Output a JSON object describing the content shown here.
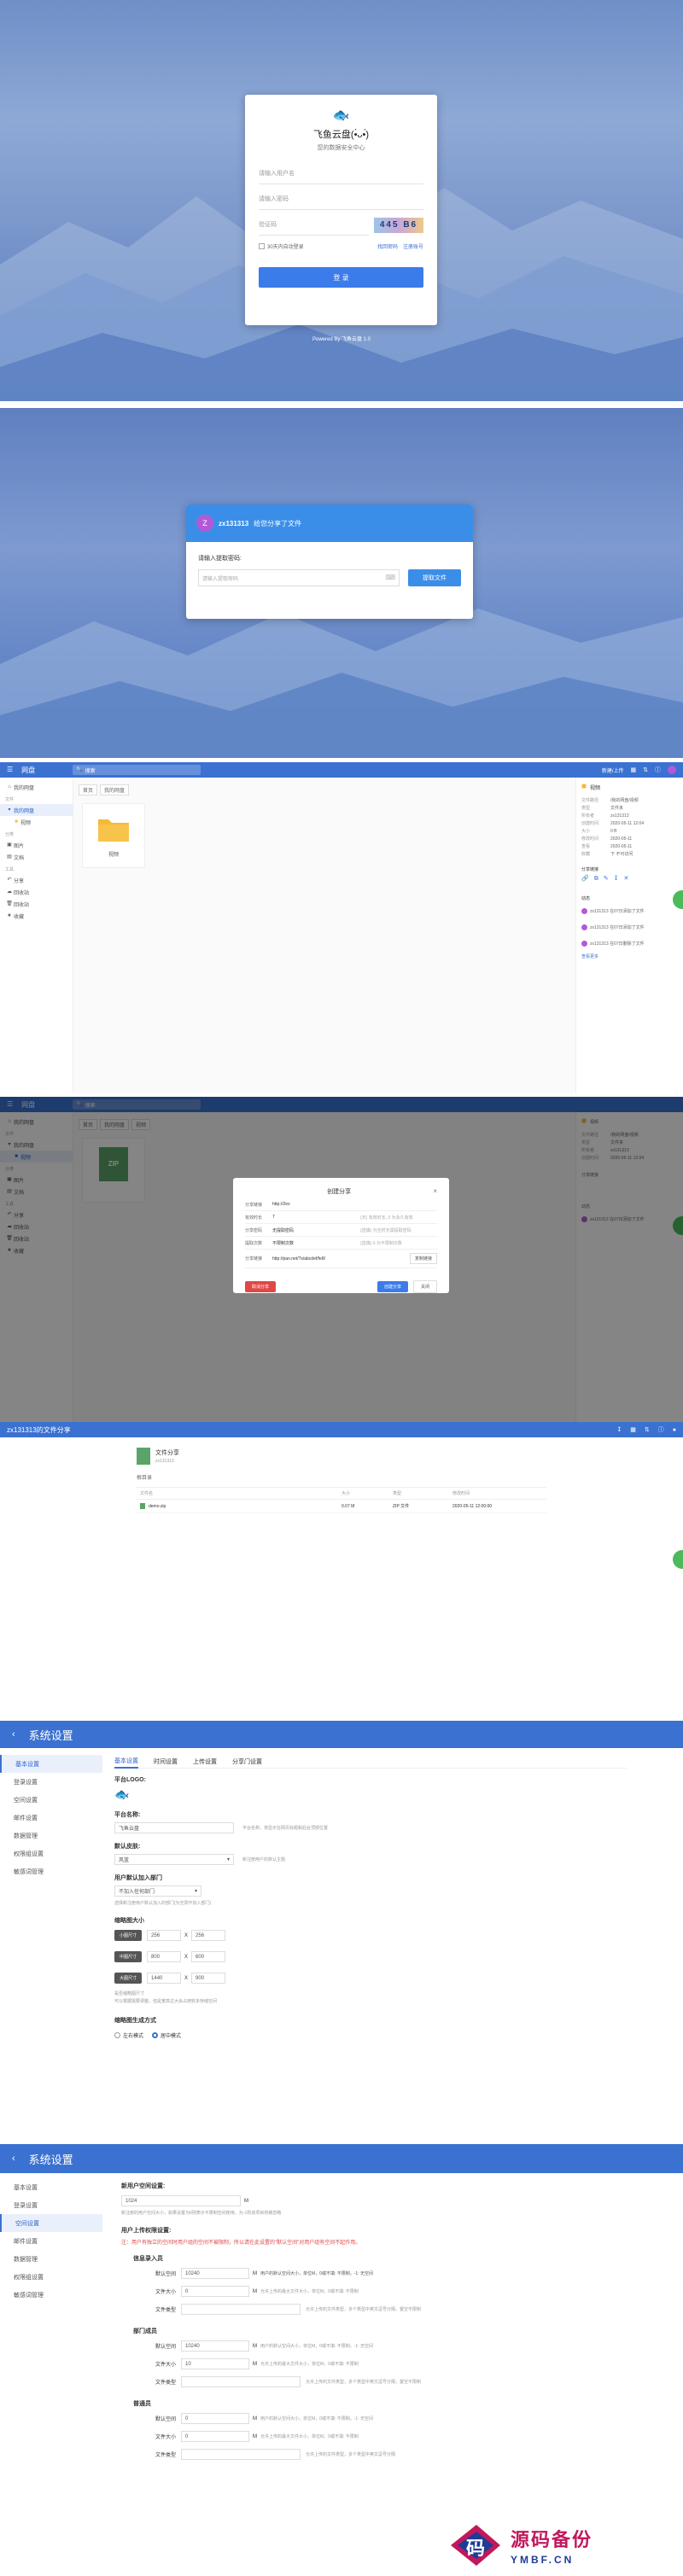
{
  "login": {
    "app_name": "飞鱼云盘(•̀ᴗ•́)",
    "subtitle": "您的数据安全中心",
    "username_placeholder": "请输入用户名",
    "password_placeholder": "请输入密码",
    "captcha_placeholder": "验证码",
    "captcha_text": "445 B6",
    "remember_label": "30天内自动登录",
    "forgot_label": "找回密码",
    "register_label": "注册账号",
    "submit_label": "登 录",
    "powered": "Powered By 飞鱼云盘 1.0"
  },
  "share": {
    "avatar_letter": "Z",
    "user": "zx131313",
    "message": "给您分享了文件",
    "prompt": "请输入提取密码:",
    "input_placeholder": "请输入提取密码",
    "extract_label": "提取文件"
  },
  "filemanager": {
    "app_title": "网盘",
    "search_placeholder": "搜索",
    "upload_label": "新建/上传",
    "sidebar": {
      "home": "我的网盘",
      "folder_head": "文件",
      "my_drive": "我的网盘",
      "sub": "视频",
      "cat_head": "分类",
      "cat1": "图片",
      "cat2": "文档",
      "tool_head": "工具",
      "t1": "分享",
      "t2": "回收站",
      "t3": "回收站",
      "t4": "收藏"
    },
    "crumbs": [
      "首页",
      "我的网盘"
    ],
    "crumbs2": [
      "首页",
      "我的网盘",
      "视频"
    ],
    "folder_name": "视频",
    "zip_name": "ZIP",
    "panel": {
      "title": "视频",
      "fields": [
        [
          "文件路径",
          "/我的网盘/视频"
        ],
        [
          "类型",
          "文件夹"
        ],
        [
          "所有者",
          "zx131313"
        ],
        [
          "创建时间",
          "2020-05-11 12:04"
        ],
        [
          "大小",
          "0 B"
        ],
        [
          "修改时间",
          "2020-05-11"
        ],
        [
          "查看",
          "2020-05-11"
        ],
        [
          "收藏",
          "下 不可访问"
        ]
      ],
      "share_head": "分享链接",
      "activity_head": "动态",
      "activity": [
        "zx131313 在07日添加了文件",
        "zx131313 在07日添加了文件",
        "zx131313 在07日删除了文件"
      ],
      "more": "查看更多"
    }
  },
  "dialog": {
    "title": "创建分享",
    "rows": [
      [
        "分享链接",
        "http://2ex",
        ""
      ],
      [
        "有效时长",
        "7",
        "(天) 有效时长, 0 为永久有效"
      ],
      [
        "分享密码",
        "无提取密码",
        "(选填) 为空时无需提取密码"
      ],
      [
        "提取次数",
        "不限制次数",
        "(选填) 0 为不限制次数"
      ],
      [
        "分享链接",
        "http://pan.net/?s/abcdef/fe8/",
        "复制链接"
      ]
    ],
    "cancel_share": "取消分享",
    "create": "创建分享",
    "close": "关闭"
  },
  "sharepage": {
    "title": "zx131313的文件分享",
    "file_title": "文件分享",
    "file_sub": "zx131313",
    "crumb": "根目录",
    "cols": [
      "文件名",
      "大小",
      "类型",
      "修改时间"
    ],
    "row": [
      "demo.zip",
      "0.07 M",
      "ZIP 文件",
      "2020-05-11 12:00:00"
    ]
  },
  "settings1": {
    "title": "系统设置",
    "nav": [
      "基本设置",
      "登录设置",
      "空间设置",
      "邮件设置",
      "数据管理",
      "权限组设置",
      "敏感词管理"
    ],
    "tabs": [
      "基本设置",
      "时间设置",
      "上传设置",
      "分享门设置"
    ],
    "logo_label": "平台LOGO:",
    "name_label": "平台名称:",
    "name_value": "飞鱼云盘",
    "name_tip": "平台名称，将显示在网页标题和后台顶部位置",
    "theme_label": "默认皮肤:",
    "theme_value": "风蓝",
    "theme_tip": "新注册用户的默认主题",
    "group_label": "用户默认加入部门",
    "group_value": "不加入任何部门",
    "group_tip": "选择新注册用户默认加入的部门(为空则不加入部门)",
    "thumb_label": "缩略图大小",
    "thumb_rows": [
      [
        "小图尺寸",
        "256",
        "256"
      ],
      [
        "中图尺寸",
        "800",
        "600"
      ],
      [
        "大图尺寸",
        "1440",
        "900"
      ]
    ],
    "thumb_tip1": "是否缩略图尺寸",
    "thumb_tip2": "可以根据需要调整，但是宽高过大会占用较多存储空间",
    "cropper_label": "缩略图生成方式",
    "crop_opts": [
      "左右模式",
      "居中模式"
    ]
  },
  "settings2": {
    "title": "系统设置",
    "quota_label": "新用户空间设置:",
    "quota_value": "1024",
    "quota_unit": "M",
    "quota_tip": "新注册的用户空间大小，如果设置为0则表示不限制空间使用，为-1则该项目将被忽略",
    "perm_label": "用户上传权限设置:",
    "perm_note": "注：用户有独立的空间时用户组的空间不被限制，所以请在此设置的\"默认空间\"对用户组有空间不起作用。",
    "groups": [
      {
        "name": "信息录入员",
        "space": "10240",
        "space_tip": "用户的默认空间大小，单位M，0或不填: 不限制，-1: 无空间",
        "size": "0",
        "size_tip": "允许上传的最大文件大小，单位M，0或不填: 不限制",
        "type_tip": "允许上传的文件类型，多个类型中英文逗号分隔，置空不限制"
      },
      {
        "name": "部门成员",
        "space": "10240",
        "space_tip": "用户的默认空间大小，单位M，0或不填: 不限制，-1: 无空间",
        "size": "10",
        "size_tip": "允许上传的最大文件大小，单位M，0或不填: 不限制",
        "type_tip": "允许上传的文件类型，多个类型中英文逗号分隔，置空不限制"
      },
      {
        "name": "普通员",
        "space": "0",
        "space_tip": "用户的默认空间大小，单位M，0或不填: 不限制，-1: 无空间",
        "size": "0",
        "size_tip": "允许上传的最大文件大小，单位M，0或不填: 不限制",
        "type_tip": "允许上传的文件类型，多个类型中英文逗号分隔"
      }
    ],
    "space_label": "默认空间",
    "size_label": "文件大小",
    "type_label": "文件类型",
    "unit": "M"
  },
  "watermark": {
    "main": "源码备份",
    "sub": "YMBF.CN",
    "glyph": "码"
  },
  "colors": {
    "accent": "#3b71d1",
    "danger": "#e04747",
    "gold": "#f5b93a"
  }
}
